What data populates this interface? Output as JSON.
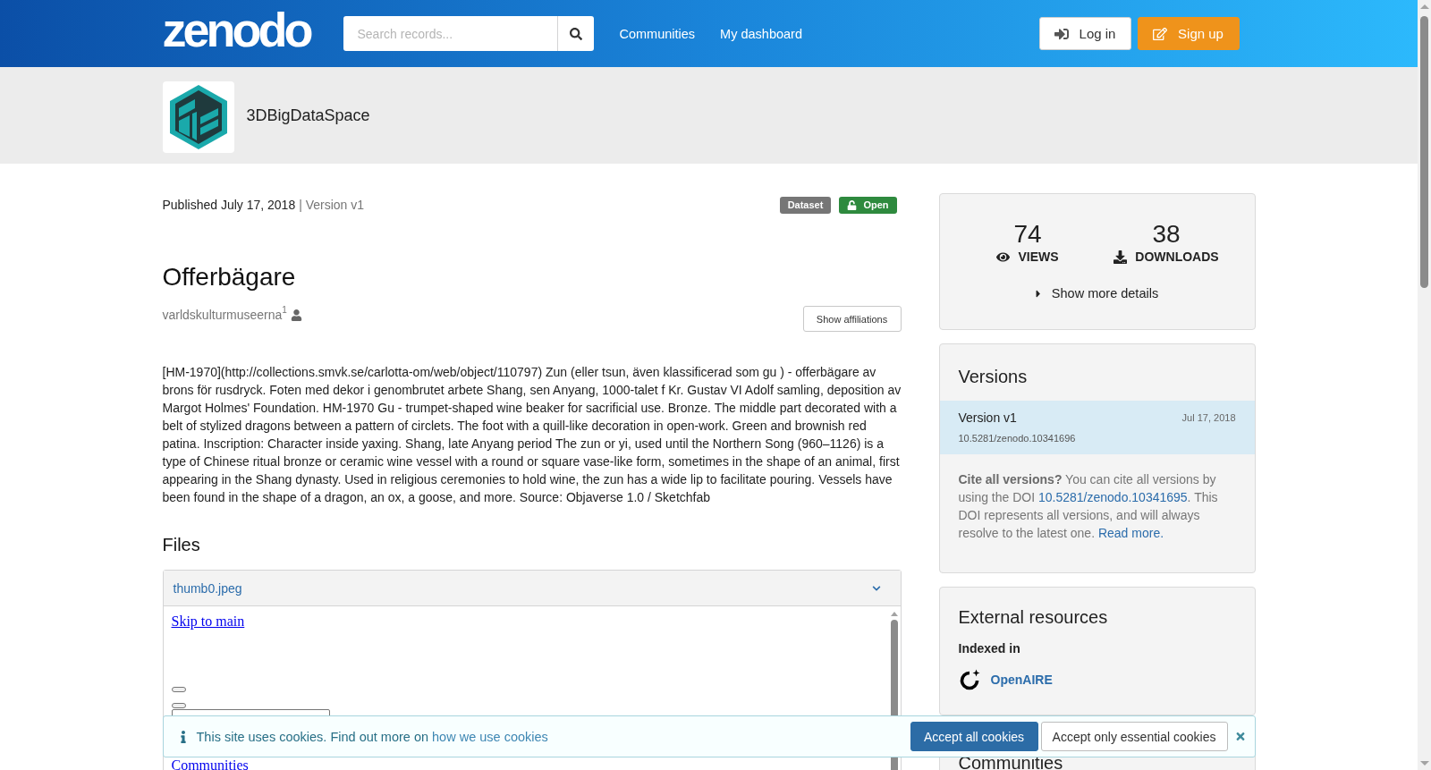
{
  "header": {
    "logo": "zenodo",
    "search": {
      "placeholder": "Search records..."
    },
    "nav": [
      "Communities",
      "My dashboard"
    ],
    "buttons": [
      {
        "label": "Log in",
        "kind": "login"
      },
      {
        "label": "Sign up",
        "kind": "signup"
      }
    ]
  },
  "community": {
    "name": "3DBigDataSpace"
  },
  "record": {
    "published": "Published July 17, 2018",
    "version": "| Version v1",
    "badges": [
      {
        "label": "Dataset",
        "kind": "type"
      },
      {
        "label": "Open",
        "kind": "open"
      }
    ],
    "title": "Offerbägare",
    "creators": [
      {
        "name": "varldskulturmuseerna$^{1}$"
      }
    ],
    "affiliations_button": "Show affiliations",
    "description": "[HM-1970](http://collections.smvk.se/carlotta-om/web/object/110797) Zun (eller tsun, även klassificerad som gu ) - offerbägare av brons för rusdryck. Foten med dekor i genombrutet arbete Shang, sen Anyang, 1000-talet f Kr. Gustav VI Adolf samling, deposition av Margot Holmes' Foundation. HM-1970 Gu - trumpet-shaped wine beaker for sacrificial use. Bronze. The middle part decorated with a belt of stylized dragons between a pattern of circlets. The foot with a quill-like decoration in open-work. Green and brownish red patina. Inscription: Character inside yaxing. Shang, late Anyang period The zun or yi, used until the Northern Song (960–1126) is a type of Chinese ritual bronze or ceramic wine vessel with a round or square vase-like form, sometimes in the shape of an animal, first appearing in the Shang dynasty. Used in religious ceremonies to hold wine, the zun has a wide lip to facilitate pouring. Vessels have been found in the shape of a dragon, an ox, a goose, and more. Source: Objaverse 1.0 / Sketchfab",
    "files": {
      "heading": "Files",
      "items": [
        {
          "name": "thumb0.jpeg",
          "expanded": true
        }
      ],
      "preview": {
        "skip_link": "Skip to main",
        "nav_link": "Communities"
      }
    }
  },
  "sidebar": {
    "stats": [
      {
        "value": "74",
        "label": "VIEWS",
        "kind": "views"
      },
      {
        "value": "38",
        "label": "DOWNLOADS",
        "kind": "downloads"
      }
    ],
    "details_toggle": {
      "label": "Show more details",
      "expanded": false
    },
    "versions": {
      "heading": "Versions",
      "items": [
        {
          "label": "Version v1",
          "date": "Jul 17, 2018",
          "doi": "10.5281/zenodo.10341696",
          "selected": true
        }
      ],
      "cite": {
        "lead": "Cite all versions?",
        "text": "You can cite all versions by using the DOI",
        "doi_link": "10.5281/zenodo.10341695",
        "after": ". This DOI represents all versions, and will always resolve to the latest one.",
        "read_more": "Read more."
      }
    },
    "external": {
      "heading": "External resources",
      "subheading": "Indexed in",
      "links": [
        "OpenAIRE"
      ]
    },
    "communities": {
      "heading": "Communities"
    }
  },
  "cookie_banner": {
    "text": "This site uses cookies. Find out more on",
    "link": "how we use cookies",
    "buttons": [
      {
        "label": "Accept all cookies",
        "kind": "primary"
      },
      {
        "label": "Accept only essential cookies",
        "kind": "secondary"
      }
    ]
  }
}
